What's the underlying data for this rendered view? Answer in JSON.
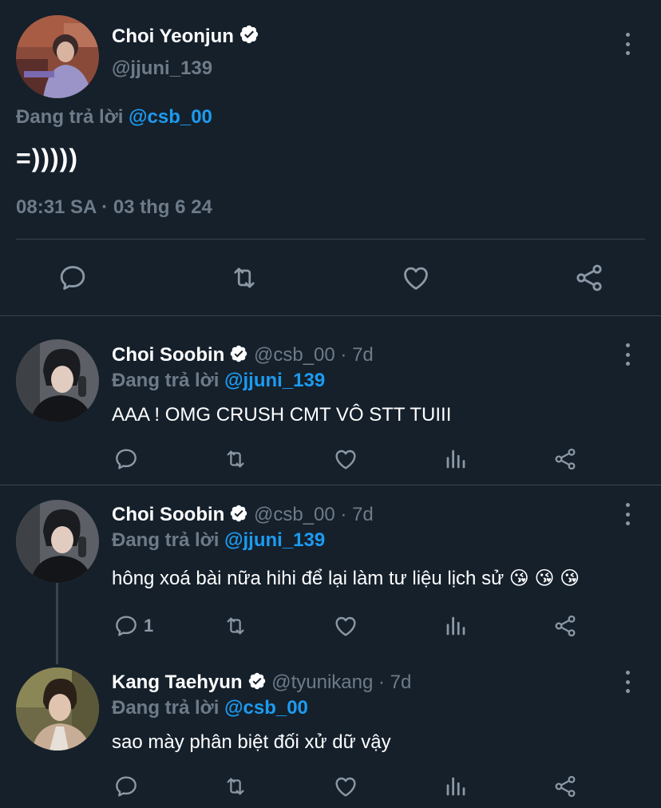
{
  "main_tweet": {
    "name": "Choi Yeonjun",
    "handle": "@jjuni_139",
    "reply_prefix": "Đang trả lời",
    "reply_to": "@csb_00",
    "text": "=)))))",
    "timestamp": "08:31 SA · 03 thg 6 24"
  },
  "replies": [
    {
      "name": "Choi Soobin",
      "meta": "@csb_00 · 7d",
      "reply_prefix": "Đang trả lời",
      "reply_to": "@jjuni_139",
      "text": "AAA ! OMG CRUSH CMT VÔ STT TUIII",
      "reply_count": ""
    },
    {
      "name": "Choi Soobin",
      "meta": "@csb_00 · 7d",
      "reply_prefix": "Đang trả lời",
      "reply_to": "@jjuni_139",
      "text": "hông xoá bài nữa hihi để lại làm tư liệu lịch sử 😘 😘 😘",
      "reply_count": "1"
    },
    {
      "name": "Kang Taehyun",
      "meta": "@tyunikang · 7d",
      "reply_prefix": "Đang trả lời",
      "reply_to": "@csb_00",
      "text": "sao mày phân biệt đối xử dữ vậy",
      "reply_count": ""
    }
  ],
  "colors": {
    "background": "#15202b",
    "accent": "#1d9bf0",
    "muted": "#6e7b88",
    "divider": "#38444d"
  }
}
